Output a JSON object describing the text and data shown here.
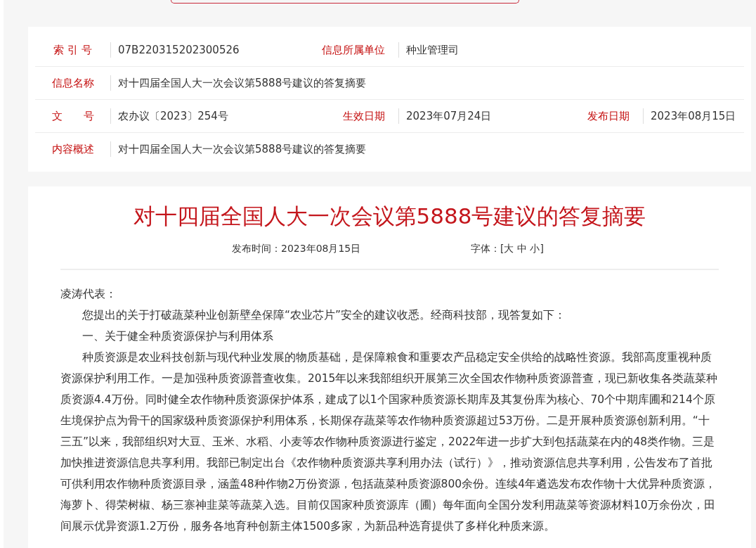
{
  "info_rows": [
    {
      "fields": [
        {
          "label": "索 引 号",
          "value": "07B220315202300526"
        },
        {
          "label": "信息所属单位",
          "value": "种业管理司"
        }
      ]
    },
    {
      "fields": [
        {
          "label": "信息名称",
          "value": "对十四届全国人大一次会议第5888号建议的答复摘要"
        }
      ]
    },
    {
      "fields": [
        {
          "label": "文　　号",
          "value": "农办议〔2023〕254号"
        },
        {
          "label": "生效日期",
          "value": "2023年07月24日"
        },
        {
          "label": "发布日期",
          "value": "2023年08月15日"
        }
      ]
    },
    {
      "fields": [
        {
          "label": "内容概述",
          "value": "对十四届全国人大一次会议第5888号建议的答复摘要"
        }
      ]
    }
  ],
  "article": {
    "title": "对十四届全国人大一次会议第5888号建议的答复摘要",
    "published": "发布时间：2023年08月15日",
    "font_size": {
      "label": "字体：",
      "open": "[",
      "options": [
        "大",
        "中",
        "小"
      ],
      "close": "]"
    },
    "paragraphs": [
      {
        "kind": "salutation",
        "text": "凌涛代表："
      },
      {
        "kind": "body",
        "text": "您提出的关于打破蔬菜种业创新壁垒保障“农业芯片”安全的建议收悉。经商科技部，现答复如下："
      },
      {
        "kind": "body",
        "text": "一、关于健全种质资源保护与利用体系"
      },
      {
        "kind": "body",
        "text": "种质资源是农业科技创新与现代种业发展的物质基础，是保障粮食和重要农产品稳定安全供给的战略性资源。我部高度重视种质资源保护利用工作。一是加强种质资源普查收集。2015年以来我部组织开展第三次全国农作物种质资源普查，现已新收集各类蔬菜种质资源4.4万份。同时健全农作物种质资源保护体系，建成了以1个国家种质资源长期库及其复份库为核心、70个中期库圃和214个原生境保护点为骨干的国家级种质资源保护利用体系，长期保存蔬菜等农作物种质资源超过53万份。二是开展种质资源创新利用。“十三五”以来，我部组织对大豆、玉米、水稻、小麦等农作物种质资源进行鉴定，2022年进一步扩大到包括蔬菜在内的48类作物。三是加快推进资源信息共享利用。我部已制定出台《农作物种质资源共享利用办法（试行）》，推动资源信息共享利用，公告发布了首批可供利用农作物种质资源目录，涵盖48种作物2万份资源，包括蔬菜种质资源800余份。连续4年遴选发布农作物十大优异种质资源，海萝卜、得荣树椒、杨三寨神韭菜等蔬菜入选。目前仅国家种质资源库（圃）每年面向全国分发利用蔬菜等资源材料10万余份次，田间展示优异资源1.2万份，服务各地育种创新主体1500多家，为新品种选育提供了多样化种质来源。"
      }
    ]
  }
}
